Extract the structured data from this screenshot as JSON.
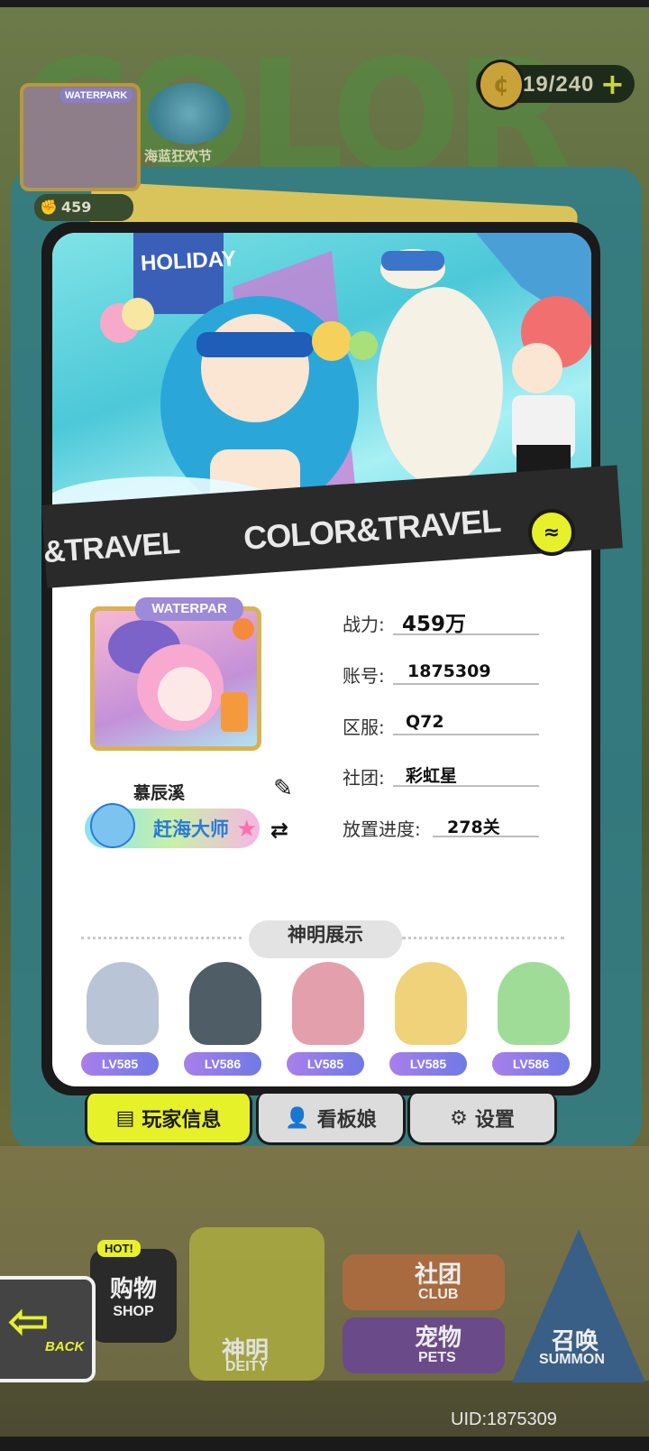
{
  "top_bar": {
    "currency_count": "19/240",
    "currency_plus": "+",
    "avatar_frame_tag": "WATERPARK",
    "event_label": "海蓝狂欢节",
    "power_short": "459"
  },
  "banner": {
    "sign_text": "HOLIDAY",
    "ribbon_left": "&TRAVEL",
    "ribbon_main": "COLOR&TRAVEL",
    "ribbon_badge": "≈"
  },
  "profile": {
    "avatar_frame_tag": "WATERPAR",
    "player_name": "慕辰溪",
    "title_badge": "赶海大师",
    "fields": [
      {
        "label": "战力:",
        "value": "459万"
      },
      {
        "label": "账号:",
        "value": "1875309"
      },
      {
        "label": "区服:",
        "value": "Q72"
      },
      {
        "label": "社团:",
        "value": "彩虹星"
      },
      {
        "label": "放置进度:",
        "value": "278关"
      }
    ]
  },
  "deities": {
    "section_title": "神明展示",
    "items": [
      {
        "level": "LV585",
        "color": "#8fb4e6"
      },
      {
        "level": "LV586",
        "color": "#5a6d7a"
      },
      {
        "level": "LV585",
        "color": "#e88a9a"
      },
      {
        "level": "LV585",
        "color": "#f2d46a"
      },
      {
        "level": "LV586",
        "color": "#8ed88a"
      }
    ]
  },
  "tabs": [
    {
      "label": "玩家信息",
      "icon": "document-icon"
    },
    {
      "label": "看板娘",
      "icon": "person-icon"
    },
    {
      "label": "设置",
      "icon": "gear-icon"
    }
  ],
  "nav": {
    "shop_cn": "购物",
    "shop_en": "SHOP",
    "shop_badge": "HOT!",
    "deity_cn": "神明",
    "deity_en": "DEITY",
    "club_cn": "社团",
    "club_en": "CLUB",
    "pets_cn": "宠物",
    "pets_en": "PETS",
    "summon_cn": "召唤",
    "summon_en": "SUMMON",
    "back": "BACK"
  },
  "uid": "UID:1875309",
  "colors": {
    "accent_yellow": "#e6f12a",
    "card_dark": "#1a1a1a",
    "level_purple": "#8b7ae8"
  }
}
